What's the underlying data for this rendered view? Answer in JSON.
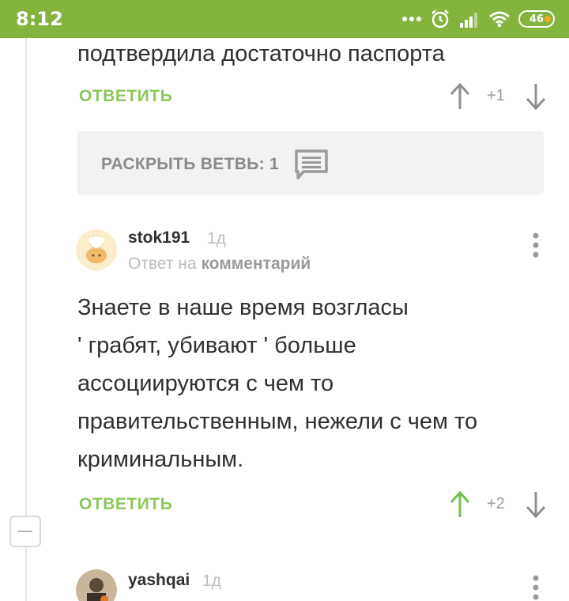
{
  "status_bar": {
    "time": "8:12",
    "battery": "46",
    "icons": [
      "dots-icon",
      "alarm-icon",
      "signal-icon",
      "wifi-icon",
      "battery-icon"
    ]
  },
  "comment_prev": {
    "text_tail": "подтвердила достаточно паспорта",
    "reply_label": "ОТВЕТИТЬ",
    "score": "+1"
  },
  "expand_thread": {
    "label": "РАСКРЫТЬ ВЕТВЬ: 1"
  },
  "comment_main": {
    "username": "stok191",
    "time": "1д",
    "reply_to_prefix": "Ответ на",
    "reply_to_link": "комментарий",
    "text_lines": [
      "Знаете в наше время возгласы",
      "' грабят, убивают ' больше",
      "ассоциируются с чем то",
      "правительственным, нежели с чем то",
      "криминальным."
    ],
    "reply_label": "ОТВЕТИТЬ",
    "score": "+2"
  },
  "comment_next": {
    "username": "yashqai",
    "time": "1д"
  },
  "colors": {
    "brand_green": "#84b33e",
    "reply_green": "#8ac858",
    "upvoted_green": "#72c04e"
  }
}
